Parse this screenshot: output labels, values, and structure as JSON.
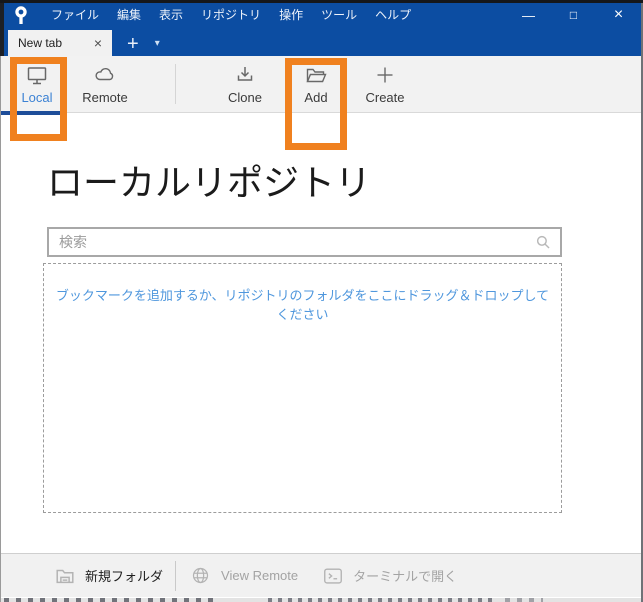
{
  "titlebar": {
    "menu": [
      "ファイル",
      "編集",
      "表示",
      "リポジトリ",
      "操作",
      "ツール",
      "ヘルプ"
    ],
    "controls": {
      "minimize": "—",
      "maximize": "□",
      "close": "×"
    }
  },
  "tab_bar": {
    "tab_label": "New tab",
    "close_glyph": "×",
    "new_tab_glyph": "+",
    "dropdown_glyph": "▾"
  },
  "toolbar": {
    "local_label": "Local",
    "remote_label": "Remote",
    "clone_label": "Clone",
    "add_label": "Add",
    "create_label": "Create"
  },
  "main": {
    "heading": "ローカルリポジトリ",
    "search_placeholder": "検索",
    "drop_hint": "ブックマークを追加するか、リポジトリのフォルダをここにドラッグ＆ドロップしてください"
  },
  "status_bar": {
    "new_folder_label": "新規フォルダ",
    "view_remote_label": "View Remote",
    "open_terminal_label": "ターミナルで開く"
  },
  "icons": {
    "logo": "sourcetree-pin",
    "local": "monitor",
    "remote": "cloud",
    "clone": "download",
    "add": "open-folder",
    "create": "plus",
    "search": "magnifier",
    "new_folder": "folder",
    "view_remote": "globe",
    "open_terminal": "terminal-prompt"
  },
  "colors": {
    "titlebar_blue": "#0c4da2",
    "accent_orange": "#f0811f",
    "active_blue": "#3c82d4",
    "underline_navy": "#1d4d99",
    "hint_blue": "#4f97dd"
  }
}
